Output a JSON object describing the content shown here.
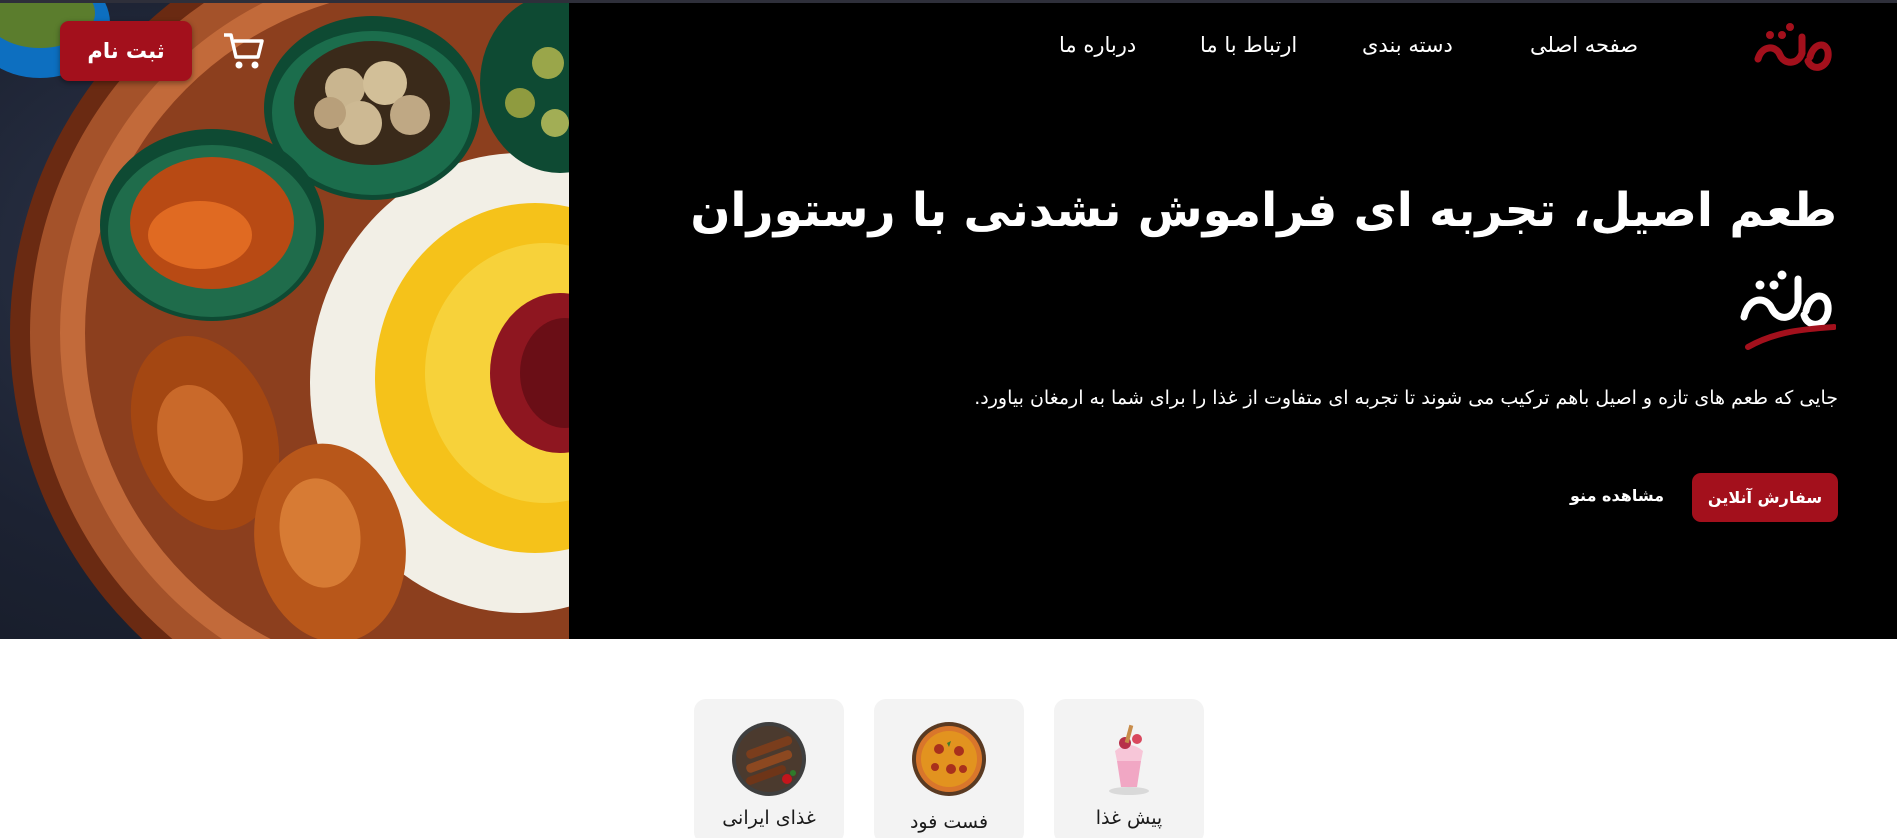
{
  "brand": {
    "logo_text": "تنور",
    "accent_color": "#a3101c"
  },
  "nav": {
    "items": [
      {
        "label": "صفحه اصلی"
      },
      {
        "label": "دسته بندی"
      },
      {
        "label": "ارتباط با ما"
      },
      {
        "label": "درباره ما"
      }
    ],
    "signup_label": "ثبت نام",
    "cart_icon": "cart-icon"
  },
  "hero": {
    "headline": "طعم اصیل، تجربه ای فراموش نشدنی با رستوران",
    "brand_word": "تنور",
    "subtitle": "جایی که طعم های تازه و اصیل باهم ترکیب می شوند تا تجربه ای متفاوت از غذا را برای شما به ارمغان بیاورد.",
    "order_label": "سفارش آنلاین",
    "menu_label": "مشاهده منو"
  },
  "categories": [
    {
      "label": "پیش غذا",
      "icon": "dessert-glass-icon"
    },
    {
      "label": "فست فود",
      "icon": "pizza-icon"
    },
    {
      "label": "غذای ایرانی",
      "icon": "kebab-icon"
    }
  ]
}
